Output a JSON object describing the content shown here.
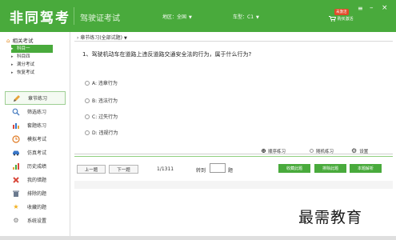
{
  "header": {
    "logo": "非同驾考",
    "title": "驾驶证考试",
    "region_label": "地区：全国",
    "vehicle_label": "车型：C1",
    "cart_label": "购买激活",
    "badge": "未激活",
    "bg_color": "#49aa3c"
  },
  "sidebar": {
    "root_label": "相关考试",
    "tree": [
      "科目一",
      "科目四",
      "满分考试",
      "恢复考试"
    ],
    "menu": [
      {
        "label": "章节练习",
        "icon": "pencil-icon"
      },
      {
        "label": "筛选练习",
        "icon": "search-icon"
      },
      {
        "label": "套题练习",
        "icon": "bar-chart-icon"
      },
      {
        "label": "模拟考试",
        "icon": "clock-icon"
      },
      {
        "label": "仿真考试",
        "icon": "car-icon"
      },
      {
        "label": "历史成绩",
        "icon": "stats-icon"
      },
      {
        "label": "我的错题",
        "icon": "wrong-icon"
      },
      {
        "label": "排除的题",
        "icon": "trash-icon"
      },
      {
        "label": "收藏的题",
        "icon": "star-icon"
      },
      {
        "label": "系统设置",
        "icon": "gear-icon"
      }
    ]
  },
  "main": {
    "breadcrumb": "章节练习(全部试题)",
    "question": "1、驾驶机动车在道路上违反道路交通安全法的行为，属于什么行为?",
    "options": [
      "A: 违章行为",
      "B: 违法行为",
      "C: 过失行为",
      "D: 违规行为"
    ],
    "modes": {
      "sequential": "顺序练习",
      "random": "随机练习",
      "settings": "设置"
    },
    "nav": {
      "prev": "上一题",
      "next": "下一题",
      "counter": "1/1311",
      "goto_label": "转到",
      "goto_value": "",
      "goto_unit": "题",
      "collect": "收藏此题",
      "delete": "排除此题",
      "explain": "本题解析"
    }
  },
  "watermark": "最需教育"
}
